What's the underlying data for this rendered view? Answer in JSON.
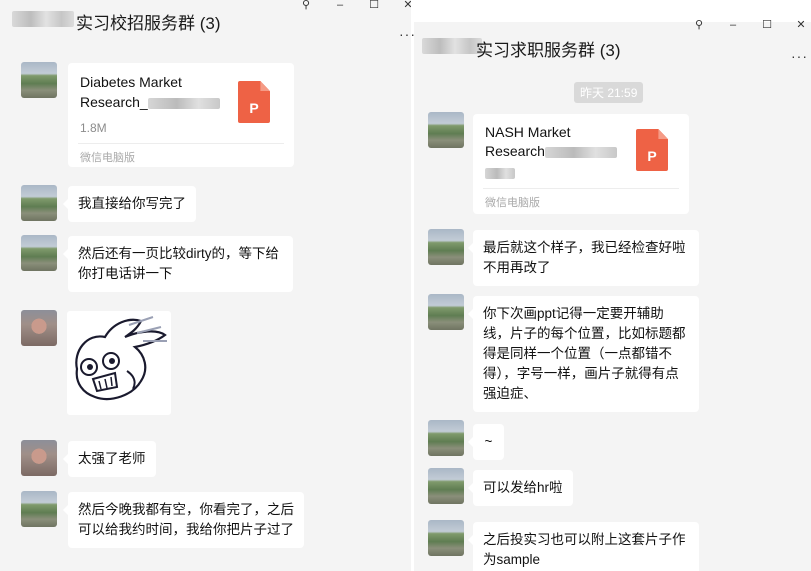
{
  "left": {
    "title": "实习校招服务群 (3)",
    "window_controls": {
      "pin": "⚲",
      "minimize": "–",
      "maximize": "☐",
      "close": "✕"
    },
    "more": "···",
    "file": {
      "name_line1": "Diabetes Market",
      "name_line2": "Research_",
      "size": "1.8M",
      "source": "微信电脑版",
      "icon_letter": "P"
    },
    "messages": [
      "我直接给你写完了",
      "然后还有一页比较dirty的，等下给你打电话讲一下",
      "太强了老师",
      "然后今晚我都有空，你看完了，之后可以给我约时间，我给你把片子过了"
    ]
  },
  "right": {
    "title": "实习求职服务群 (3)",
    "window_controls": {
      "pin": "⚲",
      "minimize": "–",
      "maximize": "☐",
      "close": "✕"
    },
    "more": "···",
    "timestamp": "昨天 21:59",
    "file": {
      "name_line1": "NASH Market",
      "name_line2": "Research",
      "source": "微信电脑版",
      "icon_letter": "P"
    },
    "messages": [
      "最后就这个样子，我已经检查好啦不用再改了",
      "你下次画ppt记得一定要开辅助线，片子的每个位置，比如标题都得是同样一个位置（一点都错不得），字号一样，画片子就得有点强迫症、",
      "~",
      "可以发给hr啦",
      "之后投实习也可以附上这套片子作为sample"
    ]
  },
  "colors": {
    "background": "#f4f4f4",
    "bubble": "#ffffff",
    "ppt_icon": "#ee6245",
    "muted_text": "#8c8c8c"
  }
}
